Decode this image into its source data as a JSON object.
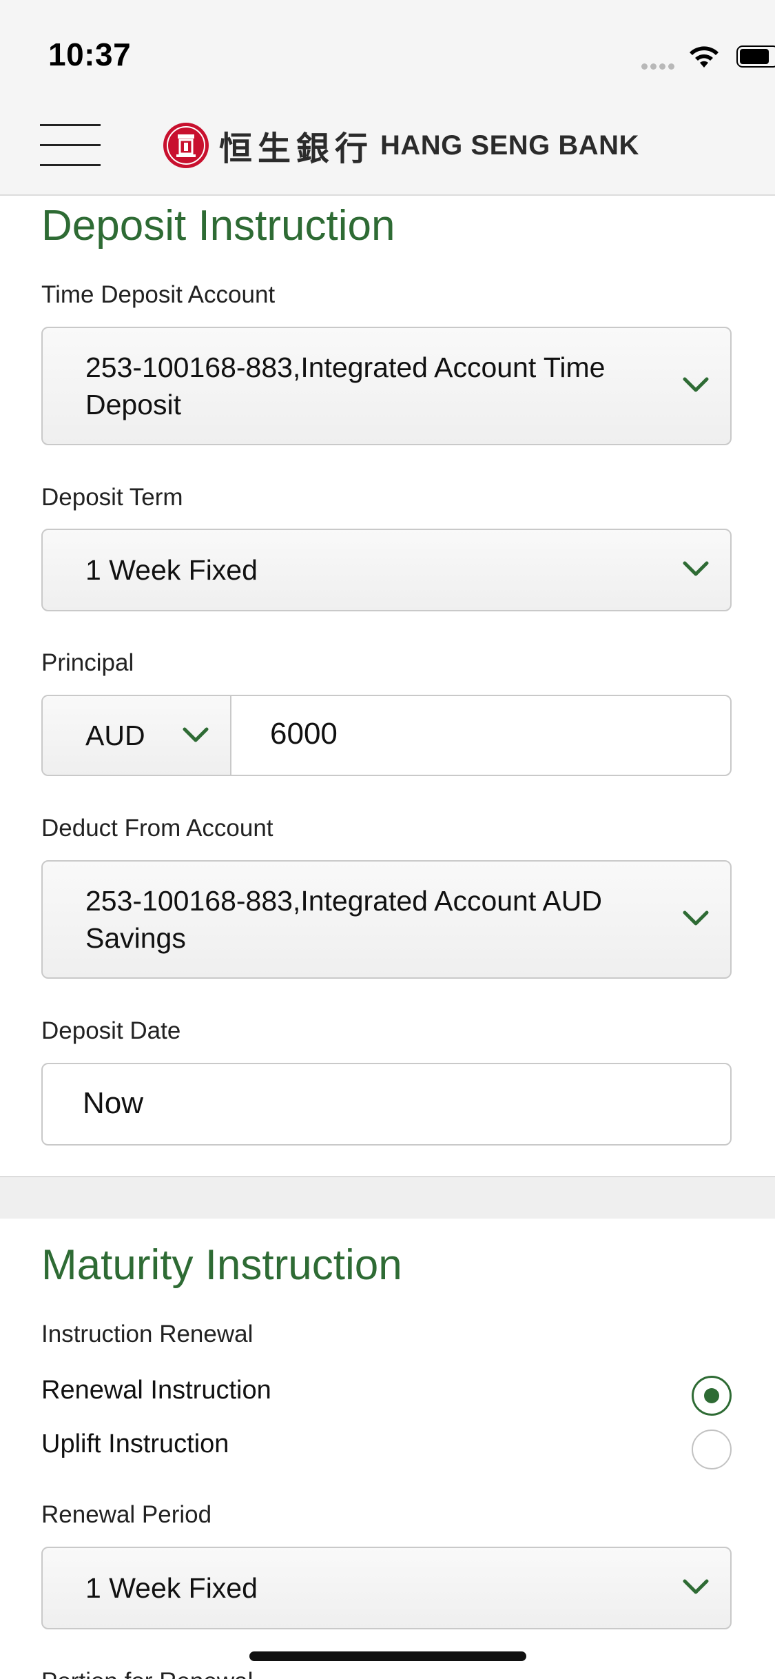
{
  "status_bar": {
    "time": "10:37"
  },
  "header": {
    "menu_icon": "hamburger-menu-icon",
    "logo_chinese": "恒生銀行",
    "logo_english": "HANG SENG BANK"
  },
  "deposit": {
    "title": "Deposit Instruction",
    "time_deposit_account": {
      "label": "Time Deposit Account",
      "line1": "253-100168-883,Integrated Account Time",
      "line2": "Deposit"
    },
    "deposit_term": {
      "label": "Deposit Term",
      "value": "1 Week Fixed"
    },
    "principal": {
      "label": "Principal",
      "currency": "AUD",
      "amount": "6000"
    },
    "deduct_from": {
      "label": "Deduct From Account",
      "line1": "253-100168-883,Integrated Account AUD",
      "line2": "Savings"
    },
    "deposit_date": {
      "label": "Deposit Date",
      "value": "Now"
    }
  },
  "maturity": {
    "title": "Maturity Instruction",
    "instruction_label": "Instruction Renewal",
    "options": [
      {
        "label": "Renewal Instruction",
        "selected": true
      },
      {
        "label": "Uplift Instruction",
        "selected": false
      }
    ],
    "renewal_period": {
      "label": "Renewal Period",
      "value": "1 Week Fixed"
    },
    "next_label_partial": "Portion for Renewal"
  },
  "colors": {
    "accent": "#2e6b34",
    "brand_red": "#c8102e"
  }
}
